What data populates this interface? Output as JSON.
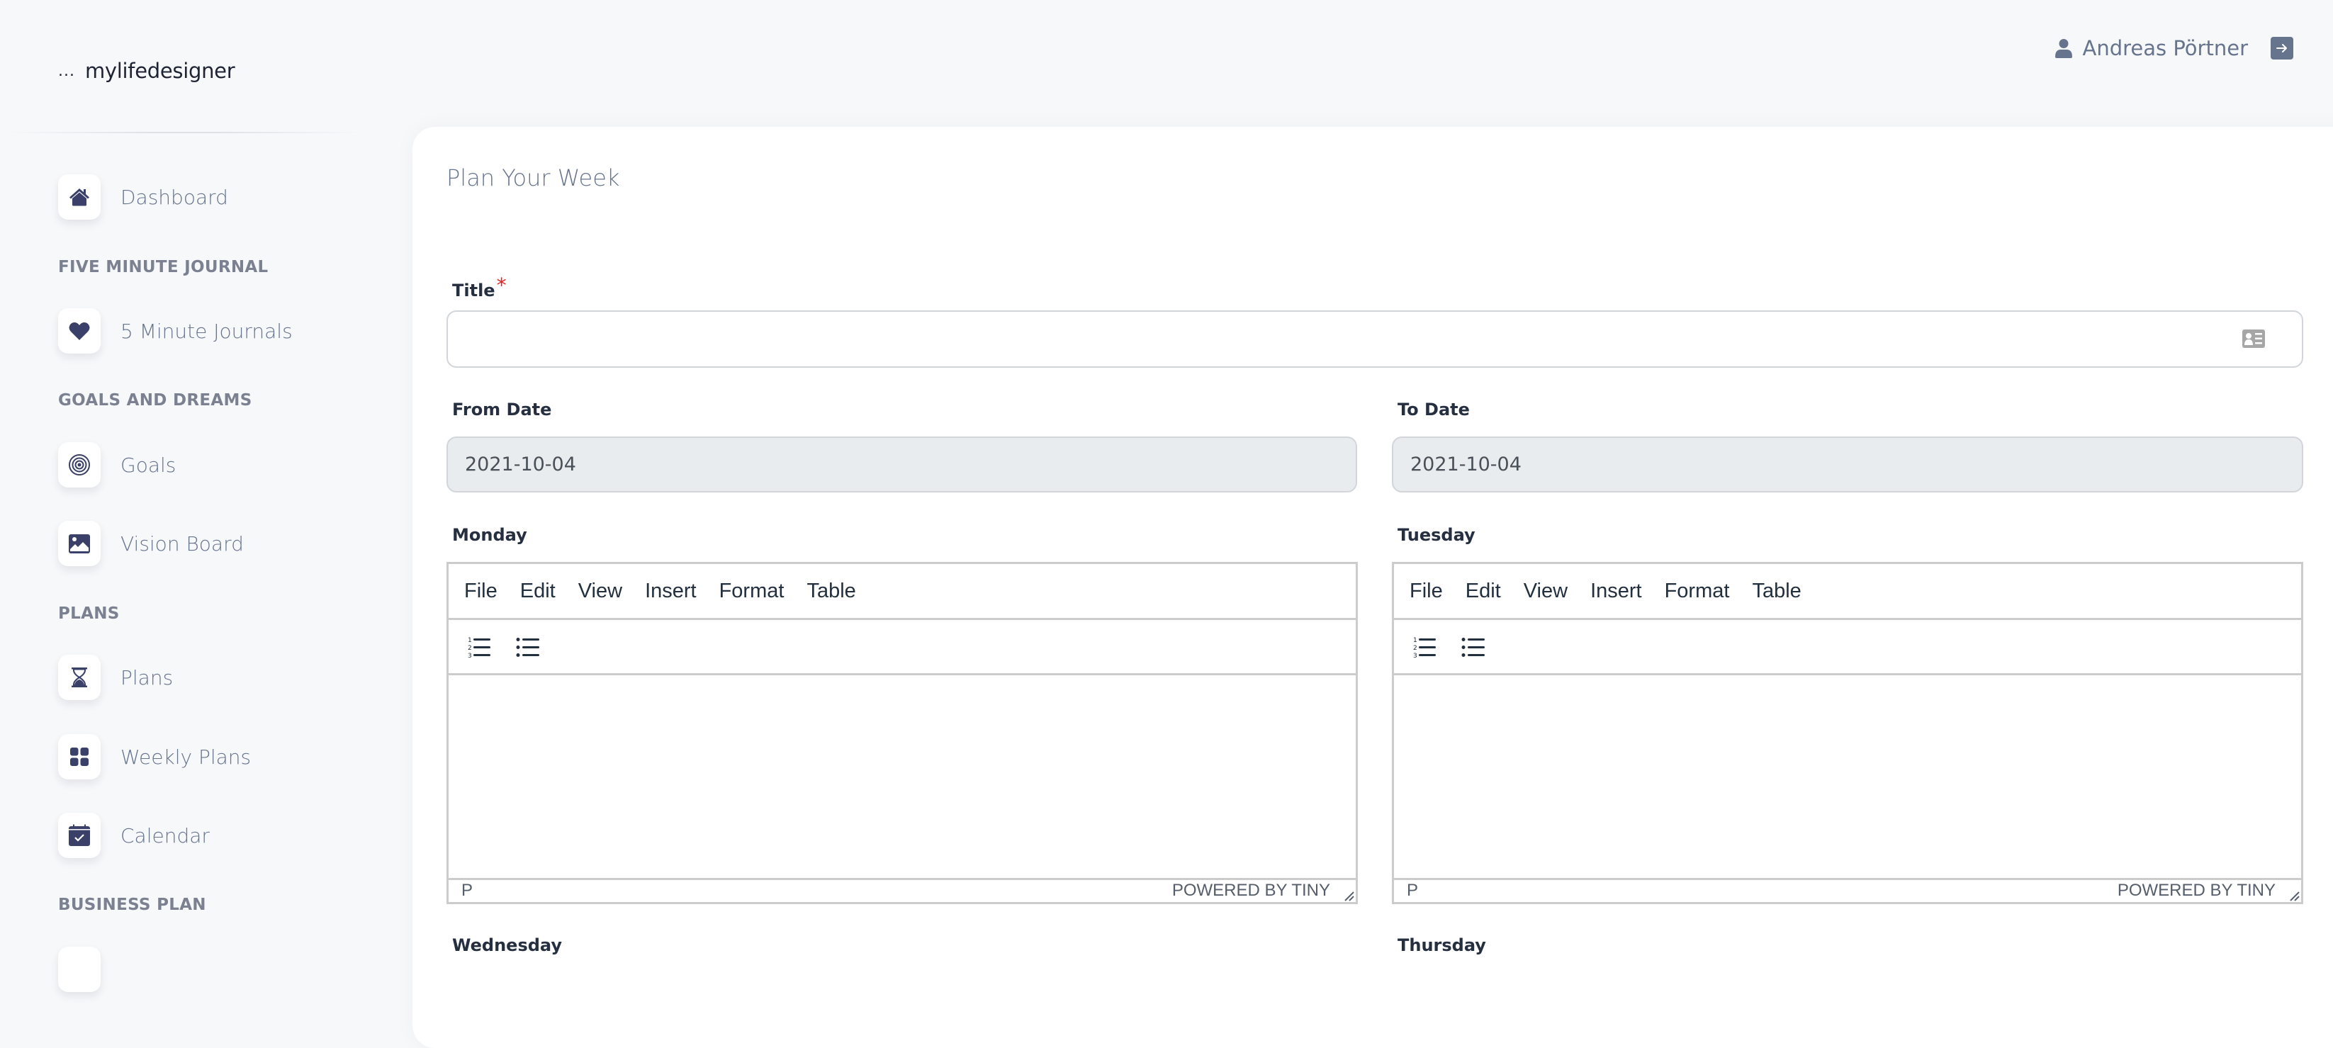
{
  "brand": {
    "prefix": "...",
    "name": "mylifedesigner"
  },
  "user": {
    "name": "Andreas Pörtner",
    "icon": "user-icon",
    "logout_icon": "logout-arrow-icon"
  },
  "sidebar": {
    "items": [
      {
        "label": "Dashboard",
        "icon": "home-icon"
      },
      {
        "section": "FIVE MINUTE JOURNAL"
      },
      {
        "label": "5 Minute Journals",
        "icon": "heart-icon"
      },
      {
        "section": "GOALS AND DREAMS"
      },
      {
        "label": "Goals",
        "icon": "target-icon"
      },
      {
        "label": "Vision Board",
        "icon": "image-icon"
      },
      {
        "section": "PLANS"
      },
      {
        "label": "Plans",
        "icon": "hourglass-icon"
      },
      {
        "label": "Weekly Plans",
        "icon": "grid-icon"
      },
      {
        "label": "Calendar",
        "icon": "calendar-check-icon"
      },
      {
        "section": "BUSINESS PLAN"
      }
    ]
  },
  "form": {
    "title": "Plan Your Week",
    "title_field": {
      "label": "Title",
      "required_mark": "*",
      "value": "",
      "icon": "contact-card-icon"
    },
    "from_date": {
      "label": "From Date",
      "value": "2021-10-04"
    },
    "to_date": {
      "label": "To Date",
      "value": "2021-10-04"
    },
    "editor_menu": [
      "File",
      "Edit",
      "View",
      "Insert",
      "Format",
      "Table"
    ],
    "editor_toolbar": [
      "numbered-list-icon",
      "bulleted-list-icon"
    ],
    "editor_status": {
      "path": "P",
      "brand": "POWERED BY TINY"
    },
    "days": [
      {
        "label": "Monday"
      },
      {
        "label": "Tuesday"
      },
      {
        "label": "Wednesday"
      },
      {
        "label": "Thursday"
      }
    ]
  },
  "colors": {
    "background": "#f7f8fa",
    "icon_primary": "#3a4068",
    "text_muted": "#67748e",
    "required": "#dc2626",
    "readonly_input": "#e9ecef"
  }
}
